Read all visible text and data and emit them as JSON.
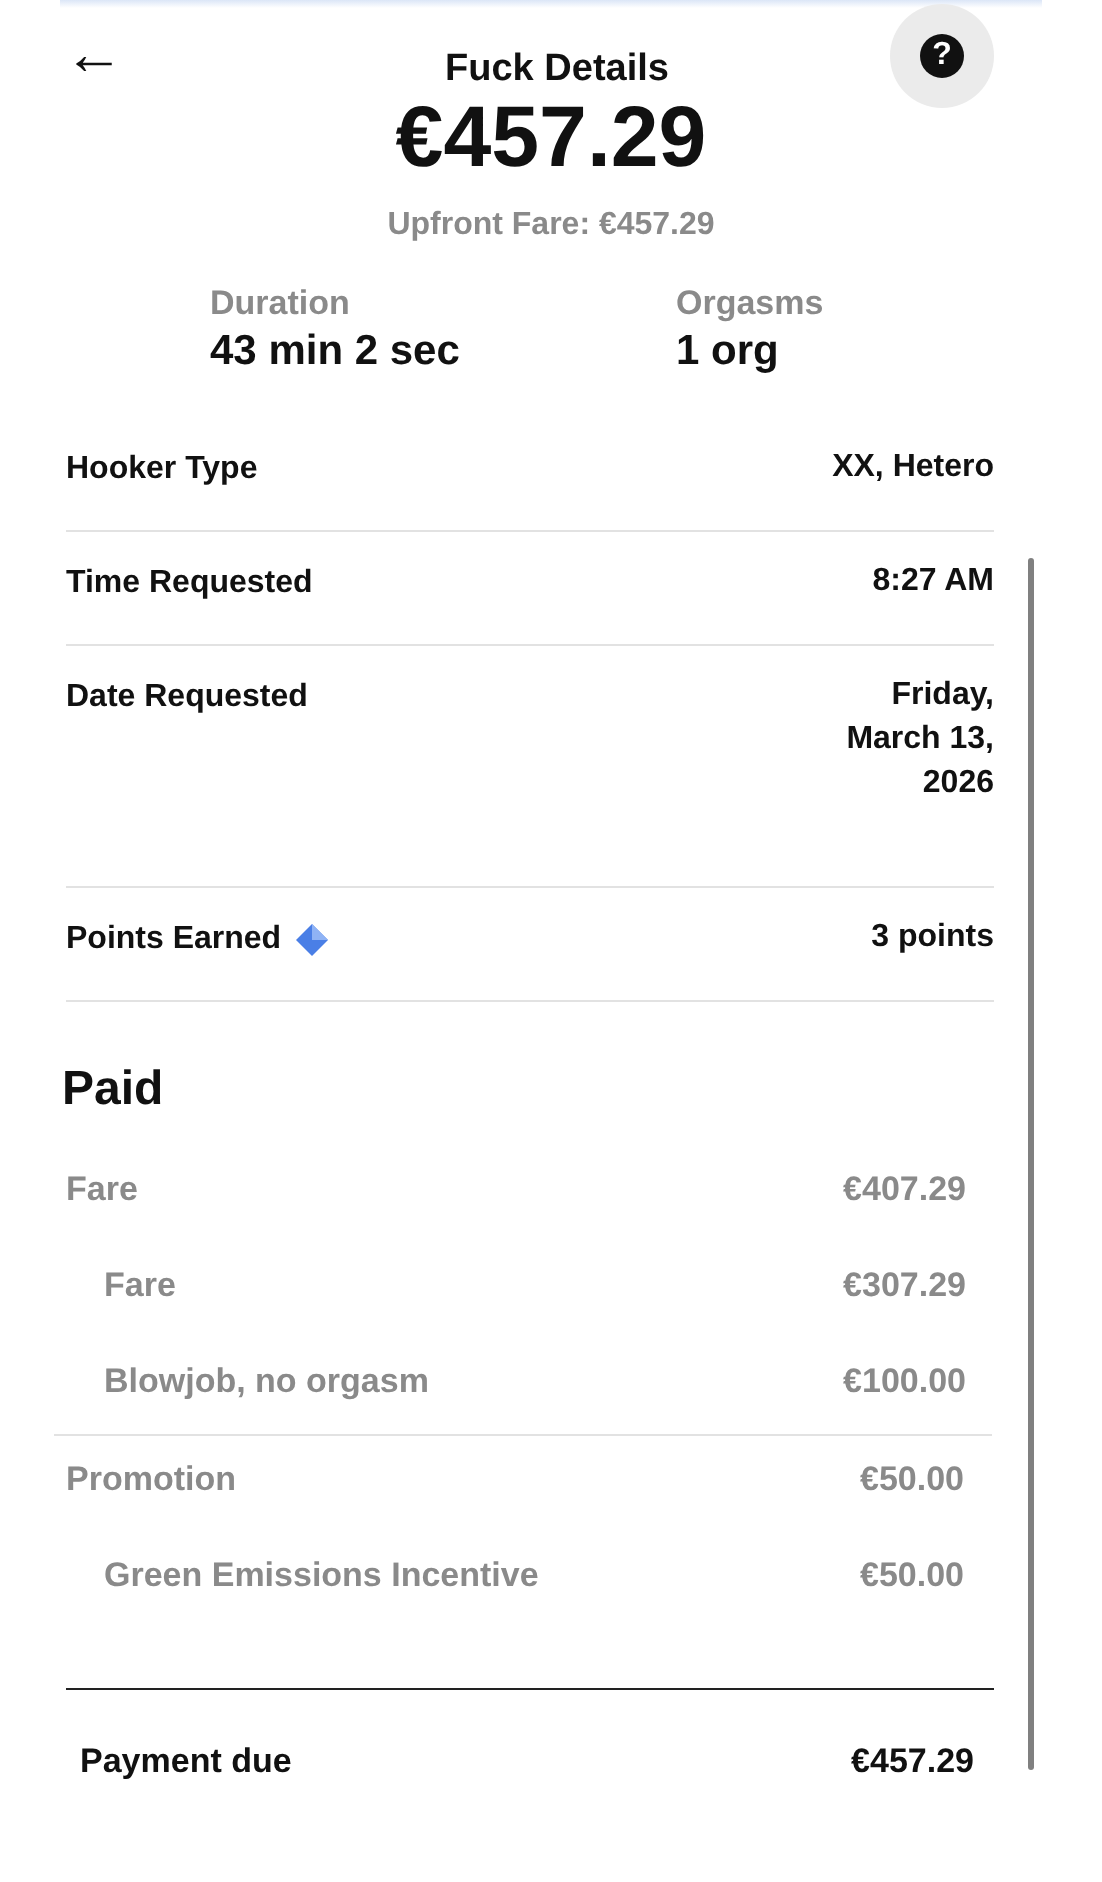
{
  "header": {
    "back": "←",
    "title": "Fuck Details",
    "help": "?"
  },
  "amount": "€457.29",
  "upfront": "Upfront Fare: €457.29",
  "stats": [
    {
      "label": "Duration",
      "value": "43 min 2 sec"
    },
    {
      "label": "Orgasms",
      "value": "1 org"
    }
  ],
  "details": [
    {
      "label": "Hooker Type",
      "value": "XX, Hetero"
    },
    {
      "label": "Time Requested",
      "value": "8:27 AM"
    },
    {
      "label": "Date Requested",
      "value": "Friday,\nMarch 13,\n2026"
    },
    {
      "label": "Points Earned",
      "value": "3 points",
      "kind": "points"
    }
  ],
  "paid": {
    "title": "Paid",
    "groups": [
      {
        "label": "Fare",
        "value": "€407.29",
        "children": [
          {
            "label": "Fare",
            "value": "€307.29"
          },
          {
            "label": "Blowjob, no orgasm",
            "value": "€100.00"
          }
        ]
      },
      {
        "label": "Promotion",
        "value": "€50.00",
        "children": [
          {
            "label": "Green Emissions Incentive",
            "value": "€50.00"
          }
        ]
      }
    ]
  },
  "total": {
    "label": "Payment due",
    "value": "€457.29"
  }
}
